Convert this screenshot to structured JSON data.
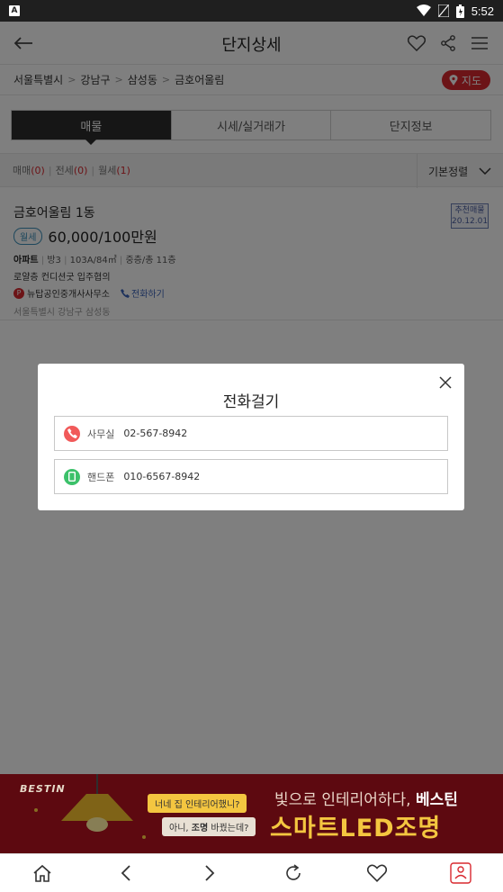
{
  "status_bar": {
    "time": "5:52"
  },
  "header": {
    "title": "단지상세"
  },
  "breadcrumb": {
    "items": [
      "서울특별시",
      "강남구",
      "삼성동",
      "금호어울림"
    ],
    "map_button": "지도"
  },
  "tabs": [
    {
      "label": "매물",
      "active": true
    },
    {
      "label": "시세/실거래가",
      "active": false
    },
    {
      "label": "단지정보",
      "active": false
    }
  ],
  "filters": {
    "sale_label": "매매",
    "sale_count": "(0)",
    "jeonse_label": "전세",
    "jeonse_count": "(0)",
    "monthly_label": "월세",
    "monthly_count": "(1)",
    "sort_label": "기본정렬"
  },
  "listing": {
    "name": "금호어울림 1동",
    "type_badge": "월세",
    "price": "60,000/100만원",
    "detail_type": "아파트",
    "detail_rooms": "방3",
    "detail_area": "103A/84㎡",
    "detail_floor": "중층/총 11층",
    "description": "로얄층 컨디션굿 입주협의",
    "agent_icon": "P",
    "agent": "뉴탑공인중개사사무소",
    "call_label": "전화하기",
    "address": "서울특별시 강남구 삼성동",
    "rec_label": "추천매물",
    "rec_date": "20.12.01"
  },
  "modal": {
    "title": "전화걸기",
    "office_label": "사무실",
    "office_number": "02-567-8942",
    "mobile_label": "핸드폰",
    "mobile_number": "010-6567-8942"
  },
  "ad": {
    "brand": "BESTIN",
    "bubble1": "너네 집 인테리어했니?",
    "bubble2_pre": "아니, ",
    "bubble2_bold": "조명",
    "bubble2_post": " 바꿨는데?",
    "line1_pre": "빛으로 인테리어하다, ",
    "line1_bold": "베스틴",
    "line2": "스마트LED조명"
  },
  "colors": {
    "accent_red": "#d8282f",
    "phone_red": "#f15a5a",
    "phone_green": "#3cc16a",
    "link_blue": "#3a63b8"
  },
  "icons": [
    "back-arrow-icon",
    "heart-icon",
    "share-icon",
    "menu-icon",
    "map-pin-icon",
    "close-icon",
    "phone-icon",
    "mobile-icon",
    "home-icon",
    "chevron-left-icon",
    "chevron-right-icon",
    "refresh-icon",
    "favorite-icon",
    "app-icon"
  ]
}
